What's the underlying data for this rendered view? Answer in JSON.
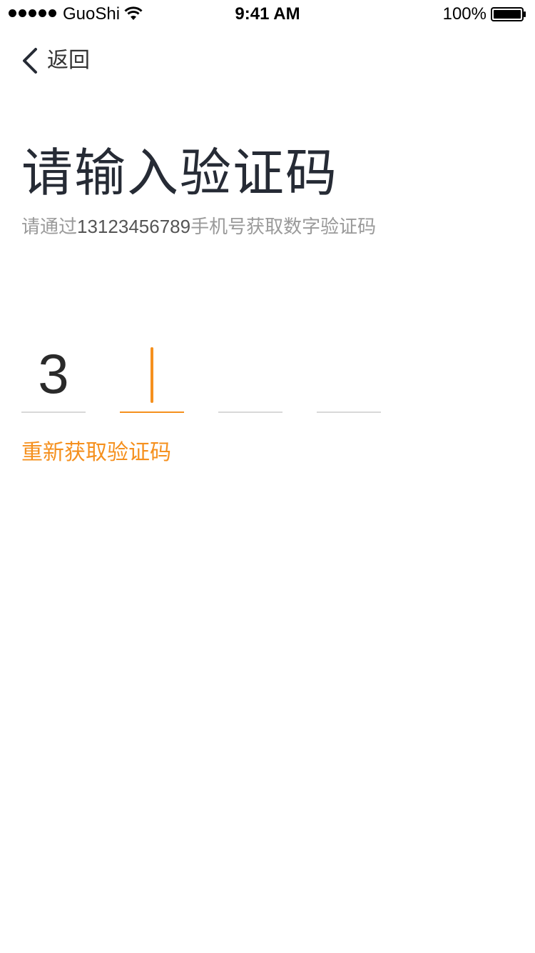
{
  "status_bar": {
    "carrier": "GuoShi",
    "time": "9:41 AM",
    "battery": "100%",
    "signal_icon": "signal-dots-icon",
    "wifi_icon": "wifi-icon",
    "battery_icon": "battery-icon"
  },
  "nav": {
    "back_label": "返回",
    "back_icon": "chevron-left-icon"
  },
  "page": {
    "title": "请输入验证码",
    "subtitle_prefix": "请通过",
    "phone": "13123456789",
    "subtitle_suffix": "手机号获取数字验证码"
  },
  "code": {
    "digits": [
      "3",
      "",
      "",
      ""
    ],
    "active_index": 1
  },
  "resend_label": "重新获取验证码",
  "colors": {
    "accent": "#f5901e",
    "title": "#262b35",
    "muted": "#9a9a9a",
    "divider": "#d8d8d8"
  }
}
